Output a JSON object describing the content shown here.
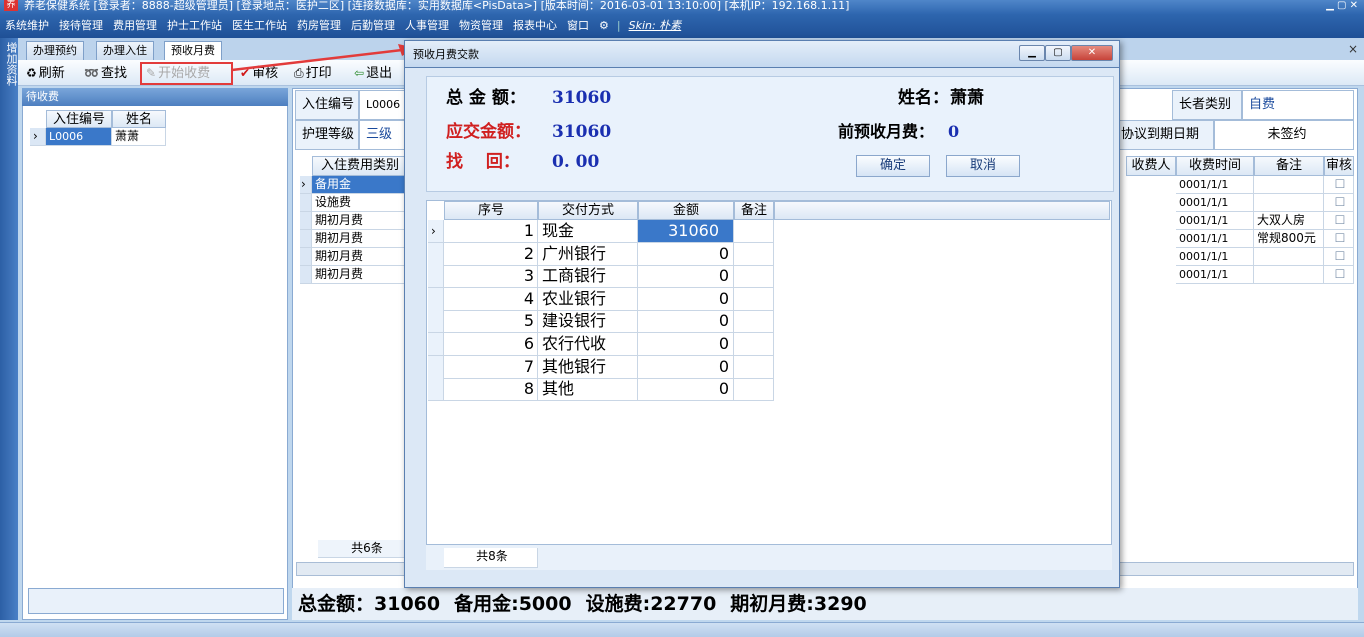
{
  "window": {
    "title": "养老保健系统 [登录者：8888-超级管理员] [登录地点：医护二区] [连接数据库：实用数据库<PisData>] [版本时间：2016-03-01 13:10:00]   [本机IP：192.168.1.11]"
  },
  "menu": {
    "items": [
      "系统维护",
      "接待管理",
      "费用管理",
      "护士工作站",
      "医生工作站",
      "药房管理",
      "后勤管理",
      "人事管理",
      "物资管理",
      "报表中心",
      "窗口"
    ],
    "skin": "Skin: 朴素"
  },
  "side": {
    "label": "增加资料"
  },
  "tabs": [
    "办理预约",
    "办理入住",
    "预收月费"
  ],
  "toolbar": {
    "refresh": "刷新",
    "find": "查找",
    "start": "开始收费",
    "audit": "审核",
    "print": "打印",
    "exit": "退出"
  },
  "left": {
    "header": "待收费",
    "col1": "入住编号",
    "col2": "姓名",
    "rows": [
      {
        "id": "L0006",
        "name": "萧萧"
      }
    ]
  },
  "info": {
    "id_label": "入住编号",
    "id_value": "L0006",
    "level_label": "护理等级",
    "level_value": "三级",
    "elder_label": "长者类别",
    "elder_value": "自费",
    "agree_label": "协议到期日期",
    "agree_value": "未签约"
  },
  "fees": {
    "headers": [
      "入住费用类别",
      "收费人",
      "收费时间",
      "备注",
      "审核"
    ],
    "rows": [
      {
        "type": "备用金",
        "time": "0001/1/1",
        "note": ""
      },
      {
        "type": "设施费",
        "time": "0001/1/1",
        "note": ""
      },
      {
        "type": "期初月费",
        "time": "0001/1/1",
        "note": "大双人房"
      },
      {
        "type": "期初月费",
        "time": "0001/1/1",
        "note": "常规800元"
      },
      {
        "type": "期初月费",
        "time": "0001/1/1",
        "note": ""
      },
      {
        "type": "期初月费",
        "time": "0001/1/1",
        "note": ""
      }
    ],
    "count": "共6条"
  },
  "totals": {
    "total": "总金额：31060",
    "reserve": "备用金:5000",
    "facility": "设施费:22770",
    "initial": "期初月费:3290"
  },
  "dialog": {
    "title": "预收月费交款",
    "total_label": "总 金 额：",
    "total_value": "31060",
    "due_label": "应交金额：",
    "due_value": "31060",
    "change_label": "找　 回：",
    "change_value": "0. 00",
    "name_label": "姓名：",
    "name_value": "萧萧",
    "prepaid_label": "前预收月费：",
    "prepaid_value": "0",
    "ok": "确定",
    "cancel": "取消",
    "headers": [
      "序号",
      "交付方式",
      "金额",
      "备注"
    ],
    "rows": [
      {
        "n": "1",
        "m": "现金",
        "a": "31060"
      },
      {
        "n": "2",
        "m": "广州银行",
        "a": "0"
      },
      {
        "n": "3",
        "m": "工商银行",
        "a": "0"
      },
      {
        "n": "4",
        "m": "农业银行",
        "a": "0"
      },
      {
        "n": "5",
        "m": "建设银行",
        "a": "0"
      },
      {
        "n": "6",
        "m": "农行代收",
        "a": "0"
      },
      {
        "n": "7",
        "m": "其他银行",
        "a": "0"
      },
      {
        "n": "8",
        "m": "其他",
        "a": "0"
      }
    ],
    "count": "共8条"
  },
  "colors": {
    "accent": "#1f5096",
    "red": "#e23b3b",
    "blue_value": "#1a2fb0"
  }
}
